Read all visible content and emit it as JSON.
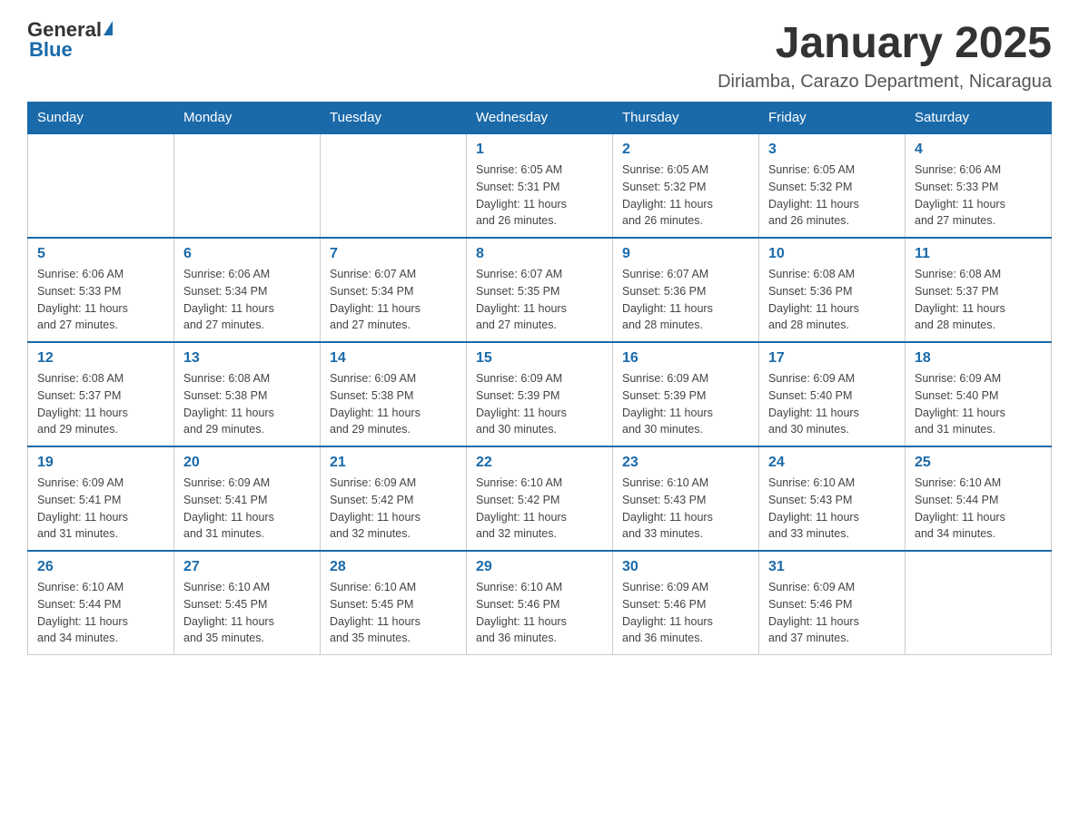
{
  "header": {
    "logo": {
      "general": "General",
      "blue": "Blue"
    },
    "title": "January 2025",
    "subtitle": "Diriamba, Carazo Department, Nicaragua"
  },
  "calendar": {
    "days_of_week": [
      "Sunday",
      "Monday",
      "Tuesday",
      "Wednesday",
      "Thursday",
      "Friday",
      "Saturday"
    ],
    "weeks": [
      [
        {
          "day": "",
          "info": ""
        },
        {
          "day": "",
          "info": ""
        },
        {
          "day": "",
          "info": ""
        },
        {
          "day": "1",
          "info": "Sunrise: 6:05 AM\nSunset: 5:31 PM\nDaylight: 11 hours\nand 26 minutes."
        },
        {
          "day": "2",
          "info": "Sunrise: 6:05 AM\nSunset: 5:32 PM\nDaylight: 11 hours\nand 26 minutes."
        },
        {
          "day": "3",
          "info": "Sunrise: 6:05 AM\nSunset: 5:32 PM\nDaylight: 11 hours\nand 26 minutes."
        },
        {
          "day": "4",
          "info": "Sunrise: 6:06 AM\nSunset: 5:33 PM\nDaylight: 11 hours\nand 27 minutes."
        }
      ],
      [
        {
          "day": "5",
          "info": "Sunrise: 6:06 AM\nSunset: 5:33 PM\nDaylight: 11 hours\nand 27 minutes."
        },
        {
          "day": "6",
          "info": "Sunrise: 6:06 AM\nSunset: 5:34 PM\nDaylight: 11 hours\nand 27 minutes."
        },
        {
          "day": "7",
          "info": "Sunrise: 6:07 AM\nSunset: 5:34 PM\nDaylight: 11 hours\nand 27 minutes."
        },
        {
          "day": "8",
          "info": "Sunrise: 6:07 AM\nSunset: 5:35 PM\nDaylight: 11 hours\nand 27 minutes."
        },
        {
          "day": "9",
          "info": "Sunrise: 6:07 AM\nSunset: 5:36 PM\nDaylight: 11 hours\nand 28 minutes."
        },
        {
          "day": "10",
          "info": "Sunrise: 6:08 AM\nSunset: 5:36 PM\nDaylight: 11 hours\nand 28 minutes."
        },
        {
          "day": "11",
          "info": "Sunrise: 6:08 AM\nSunset: 5:37 PM\nDaylight: 11 hours\nand 28 minutes."
        }
      ],
      [
        {
          "day": "12",
          "info": "Sunrise: 6:08 AM\nSunset: 5:37 PM\nDaylight: 11 hours\nand 29 minutes."
        },
        {
          "day": "13",
          "info": "Sunrise: 6:08 AM\nSunset: 5:38 PM\nDaylight: 11 hours\nand 29 minutes."
        },
        {
          "day": "14",
          "info": "Sunrise: 6:09 AM\nSunset: 5:38 PM\nDaylight: 11 hours\nand 29 minutes."
        },
        {
          "day": "15",
          "info": "Sunrise: 6:09 AM\nSunset: 5:39 PM\nDaylight: 11 hours\nand 30 minutes."
        },
        {
          "day": "16",
          "info": "Sunrise: 6:09 AM\nSunset: 5:39 PM\nDaylight: 11 hours\nand 30 minutes."
        },
        {
          "day": "17",
          "info": "Sunrise: 6:09 AM\nSunset: 5:40 PM\nDaylight: 11 hours\nand 30 minutes."
        },
        {
          "day": "18",
          "info": "Sunrise: 6:09 AM\nSunset: 5:40 PM\nDaylight: 11 hours\nand 31 minutes."
        }
      ],
      [
        {
          "day": "19",
          "info": "Sunrise: 6:09 AM\nSunset: 5:41 PM\nDaylight: 11 hours\nand 31 minutes."
        },
        {
          "day": "20",
          "info": "Sunrise: 6:09 AM\nSunset: 5:41 PM\nDaylight: 11 hours\nand 31 minutes."
        },
        {
          "day": "21",
          "info": "Sunrise: 6:09 AM\nSunset: 5:42 PM\nDaylight: 11 hours\nand 32 minutes."
        },
        {
          "day": "22",
          "info": "Sunrise: 6:10 AM\nSunset: 5:42 PM\nDaylight: 11 hours\nand 32 minutes."
        },
        {
          "day": "23",
          "info": "Sunrise: 6:10 AM\nSunset: 5:43 PM\nDaylight: 11 hours\nand 33 minutes."
        },
        {
          "day": "24",
          "info": "Sunrise: 6:10 AM\nSunset: 5:43 PM\nDaylight: 11 hours\nand 33 minutes."
        },
        {
          "day": "25",
          "info": "Sunrise: 6:10 AM\nSunset: 5:44 PM\nDaylight: 11 hours\nand 34 minutes."
        }
      ],
      [
        {
          "day": "26",
          "info": "Sunrise: 6:10 AM\nSunset: 5:44 PM\nDaylight: 11 hours\nand 34 minutes."
        },
        {
          "day": "27",
          "info": "Sunrise: 6:10 AM\nSunset: 5:45 PM\nDaylight: 11 hours\nand 35 minutes."
        },
        {
          "day": "28",
          "info": "Sunrise: 6:10 AM\nSunset: 5:45 PM\nDaylight: 11 hours\nand 35 minutes."
        },
        {
          "day": "29",
          "info": "Sunrise: 6:10 AM\nSunset: 5:46 PM\nDaylight: 11 hours\nand 36 minutes."
        },
        {
          "day": "30",
          "info": "Sunrise: 6:09 AM\nSunset: 5:46 PM\nDaylight: 11 hours\nand 36 minutes."
        },
        {
          "day": "31",
          "info": "Sunrise: 6:09 AM\nSunset: 5:46 PM\nDaylight: 11 hours\nand 37 minutes."
        },
        {
          "day": "",
          "info": ""
        }
      ]
    ]
  }
}
